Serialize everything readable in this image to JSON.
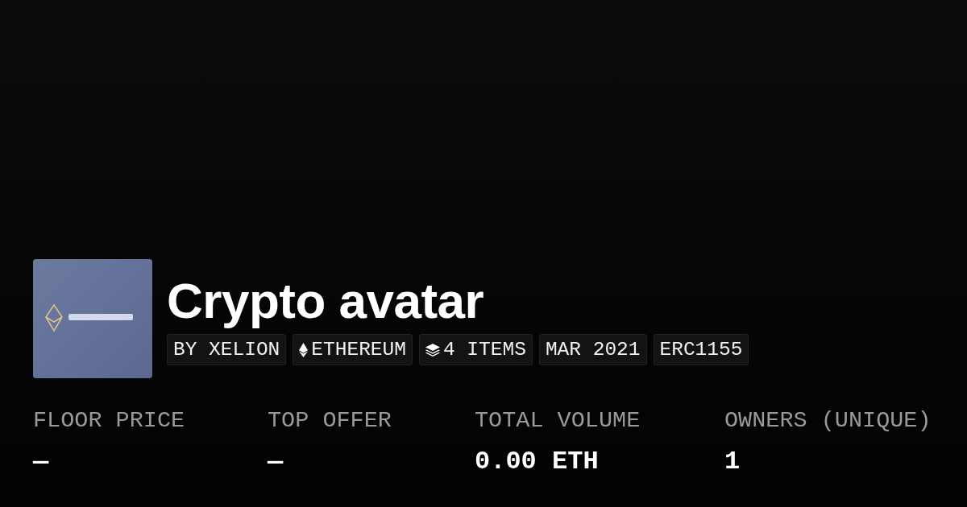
{
  "collection": {
    "title": "Crypto avatar",
    "tags": [
      {
        "kind": "text",
        "label": "BY XELION"
      },
      {
        "kind": "chain",
        "label": "ETHEREUM"
      },
      {
        "kind": "items",
        "label": "4 ITEMS"
      },
      {
        "kind": "text",
        "label": "MAR 2021"
      },
      {
        "kind": "text",
        "label": "ERC1155"
      }
    ]
  },
  "stats": [
    {
      "label": "FLOOR PRICE",
      "value": "—"
    },
    {
      "label": "TOP OFFER",
      "value": "—"
    },
    {
      "label": "TOTAL VOLUME",
      "value": "0.00 ETH"
    },
    {
      "label": "OWNERS (UNIQUE)",
      "value": "1"
    }
  ]
}
